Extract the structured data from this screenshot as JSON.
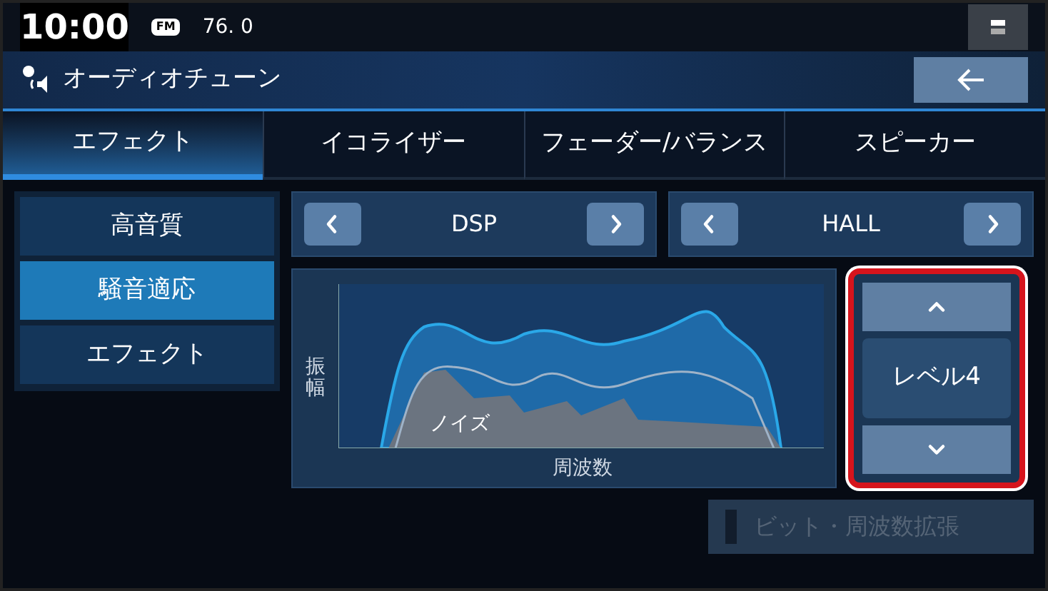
{
  "status_bar": {
    "time": "10:00",
    "source": "FM",
    "frequency": "76. 0"
  },
  "header": {
    "title": "オーディオチューン"
  },
  "tabs": [
    {
      "label": "エフェクト",
      "selected": true
    },
    {
      "label": "イコライザー",
      "selected": false
    },
    {
      "label": "フェーダー/バランス",
      "selected": false
    },
    {
      "label": "スピーカー",
      "selected": false
    }
  ],
  "sidebar": {
    "items": [
      {
        "label": "高音質",
        "selected": false
      },
      {
        "label": "騒音適応",
        "selected": true
      },
      {
        "label": "エフェクト",
        "selected": false
      }
    ]
  },
  "selectors": [
    {
      "value": "DSP"
    },
    {
      "value": "HALL"
    }
  ],
  "graph": {
    "y_label": "振幅",
    "x_label": "周波数",
    "noise_label": "ノイズ"
  },
  "level_control": {
    "value": "レベル4",
    "highlighted": true
  },
  "toggle": {
    "label": "ビット・周波数拡張",
    "on": false,
    "disabled": true
  }
}
